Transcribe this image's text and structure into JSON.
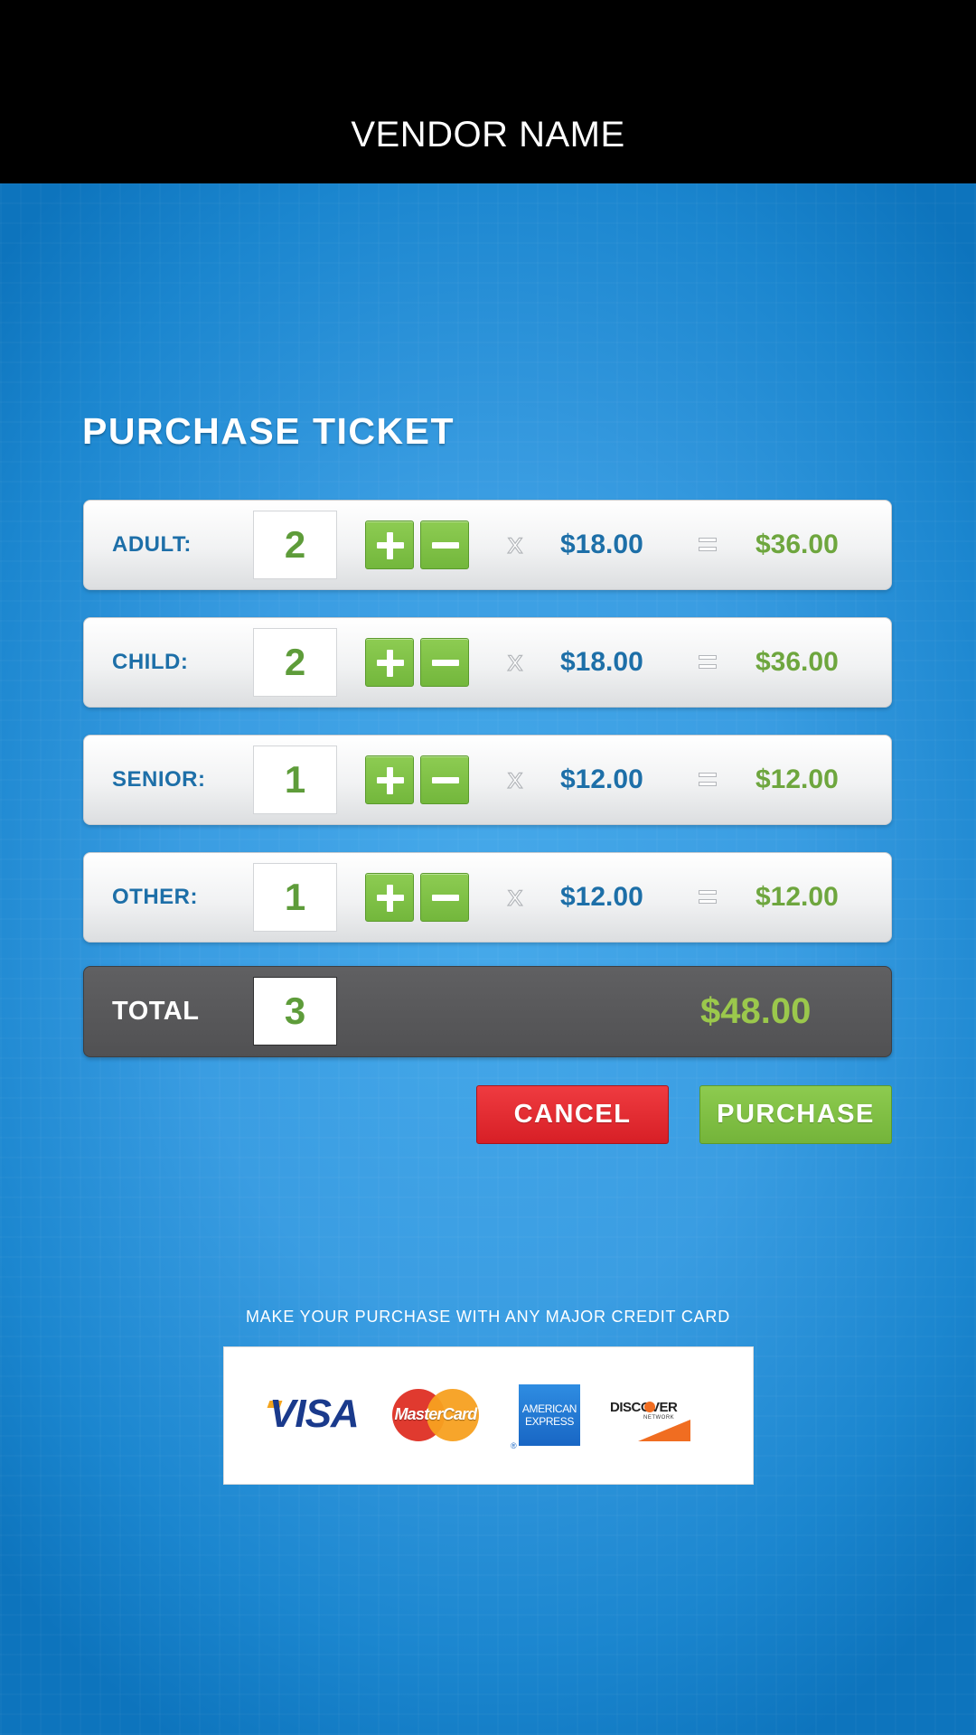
{
  "header": {
    "vendor_name": "VENDOR NAME"
  },
  "page": {
    "title": "PURCHASE TICKET"
  },
  "tickets": [
    {
      "label": "ADULT:",
      "quantity": "2",
      "times": "x",
      "unit_price": "$18.00",
      "line_total": "$36.00"
    },
    {
      "label": "CHILD:",
      "quantity": "2",
      "times": "x",
      "unit_price": "$18.00",
      "line_total": "$36.00"
    },
    {
      "label": "SENIOR:",
      "quantity": "1",
      "times": "x",
      "unit_price": "$12.00",
      "line_total": "$12.00"
    },
    {
      "label": "OTHER:",
      "quantity": "1",
      "times": "x",
      "unit_price": "$12.00",
      "line_total": "$12.00"
    }
  ],
  "icons": {
    "increment": "plus-icon",
    "decrement": "minus-icon",
    "equals": "equals-icon"
  },
  "total": {
    "label": "TOTAL",
    "quantity": "3",
    "amount": "$48.00"
  },
  "actions": {
    "cancel_label": "CANCEL",
    "purchase_label": "PURCHASE"
  },
  "payment": {
    "note": "MAKE YOUR PURCHASE WITH ANY MAJOR CREDIT CARD",
    "cards": {
      "visa": "VISA",
      "mastercard": "MasterCard",
      "amex_line1": "AMERICAN",
      "amex_line2": "EXPRESS",
      "amex_reg": "®",
      "discover": "DISCOVER",
      "discover_network": "NETWORK"
    }
  },
  "colors": {
    "background": "#3a9de2",
    "topbar": "#000000",
    "label_blue": "#1d6fa8",
    "price_green": "#6ea63e",
    "button_green": "#7dbf44",
    "cancel_red": "#e12a30",
    "total_bar": "#58585a"
  }
}
